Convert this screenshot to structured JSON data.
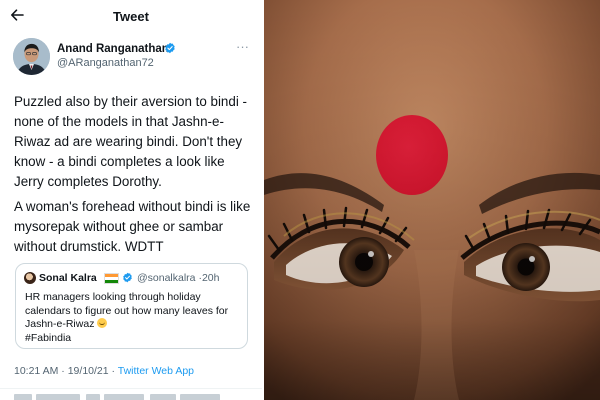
{
  "topbar": {
    "title": "Tweet",
    "back_icon": "arrow-left-icon"
  },
  "author": {
    "name": "Anand Ranganathan",
    "handle": "@ARanganathan72",
    "verified": true,
    "more_icon": "more-options-icon",
    "more_glyph": "···"
  },
  "tweet": {
    "paragraphs": [
      "Puzzled also by their aversion to bindi - none of the models in that Jashn-e-Riwaz ad are wearing bindi. Don't they know - a bindi completes a look like Jerry completes Dorothy.",
      "A woman's forehead without bindi is like mysorepak without ghee or sambar without drumstick.  WDTT"
    ]
  },
  "quote": {
    "name": "Sonal Kalra",
    "flag_colors": [
      "#ff9933",
      "#ffffff",
      "#138808"
    ],
    "handle": "@sonalkalra",
    "separator": "·",
    "time": "20h",
    "lines": [
      "HR managers looking through holiday",
      "calendars to figure out how many leaves for",
      "Jashn-e-Riwaz",
      "#Fabindia"
    ]
  },
  "meta": {
    "time": "10:21 AM",
    "separator": " · ",
    "date": "19/10/21",
    "separator2": " · ",
    "source": "Twitter Web App"
  },
  "photo": {
    "bindi_color": "#d7162f",
    "skin_color": "#a9714d"
  },
  "colors": {
    "accent": "#1d9bf0",
    "secondary_text": "#536471",
    "border": "#cfd9de"
  }
}
